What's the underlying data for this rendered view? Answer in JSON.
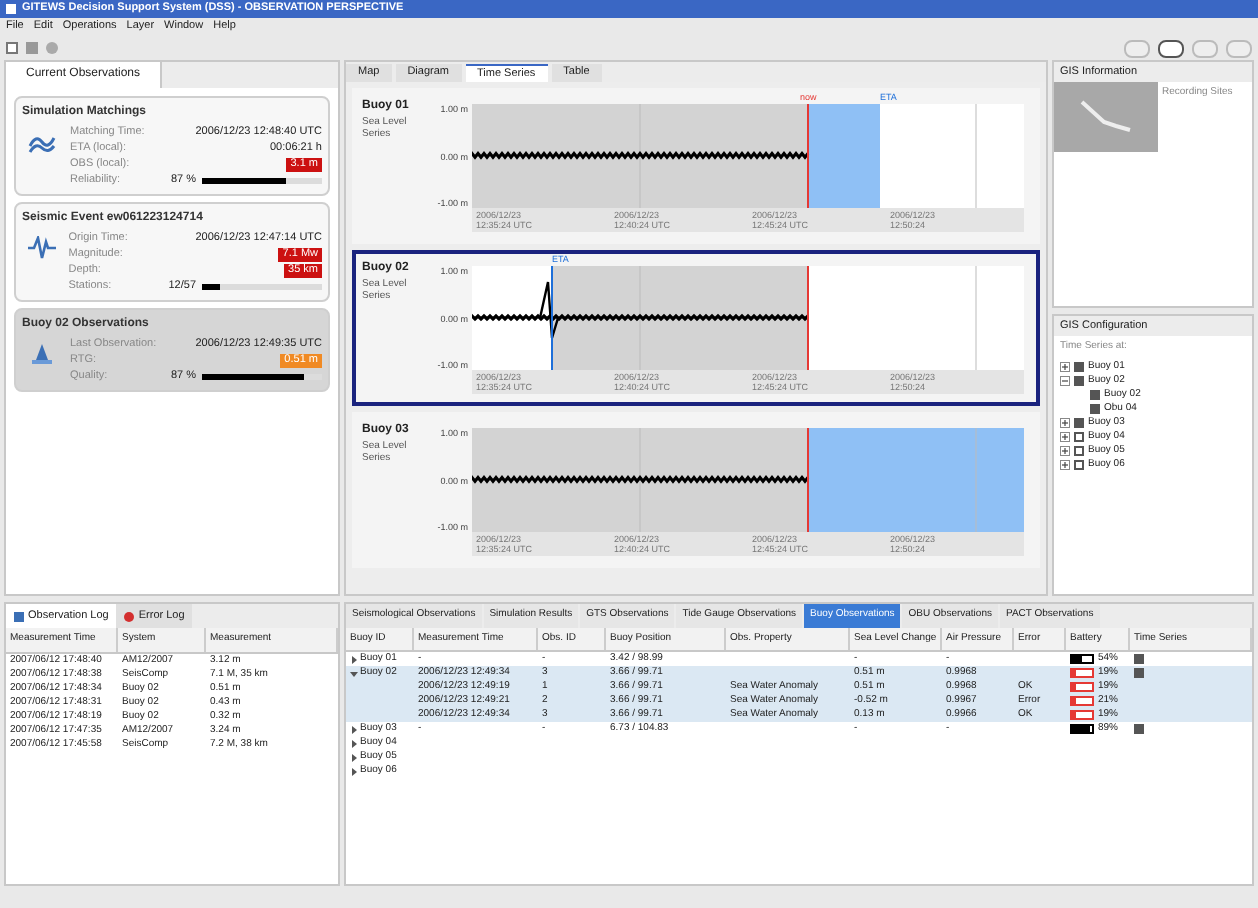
{
  "window": {
    "title": "GITEWS Decision Support System (DSS) - OBSERVATION PERSPECTIVE"
  },
  "menu": [
    "File",
    "Edit",
    "Operations",
    "Layer",
    "Window",
    "Help"
  ],
  "perspectives": [
    {
      "selected": false
    },
    {
      "selected": true
    },
    {
      "selected": false
    },
    {
      "selected": false
    }
  ],
  "current_observations": {
    "tab": "Current Observations",
    "cards": [
      {
        "title": "Simulation Matchings",
        "selected": false,
        "rows": [
          {
            "kind": "value",
            "label": "Matching Time:",
            "value": "2006/12/23 12:48:40 UTC"
          },
          {
            "kind": "value",
            "label": "ETA (local):",
            "value": "00:06:21 h"
          },
          {
            "kind": "badge",
            "label": "OBS (local):",
            "value": "3.1 m",
            "color": "#cc1111"
          },
          {
            "kind": "bar",
            "label": "Reliability:",
            "value": "87 %",
            "level": 0.7
          }
        ]
      },
      {
        "title": "Seismic Event ew061223124714",
        "selected": false,
        "rows": [
          {
            "kind": "value",
            "label": "Origin Time:",
            "value": "2006/12/23 12:47:14 UTC"
          },
          {
            "kind": "badge",
            "label": "Magnitude:",
            "value": "7.1 Mw",
            "color": "#cc1111"
          },
          {
            "kind": "badge",
            "label": "Depth:",
            "value": "35 km",
            "color": "#cc1111"
          },
          {
            "kind": "bar",
            "label": "Stations:",
            "value": "12/57",
            "level": 0.15
          }
        ]
      },
      {
        "title": "Buoy 02 Observations",
        "selected": true,
        "rows": [
          {
            "kind": "value",
            "label": "Last Observation:",
            "value": "2006/12/23 12:49:35 UTC"
          },
          {
            "kind": "badge",
            "label": "RTG:",
            "value": "0.51 m",
            "color": "#f08a24"
          },
          {
            "kind": "bar",
            "label": "Quality:",
            "value": "87 %",
            "level": 0.85
          }
        ]
      }
    ]
  },
  "center_tabs": [
    {
      "label": "Map",
      "selected": false
    },
    {
      "label": "Diagram",
      "selected": false
    },
    {
      "label": "Time Series",
      "selected": true
    },
    {
      "label": "Table",
      "selected": false
    }
  ],
  "charts": [
    {
      "name": "Buoy 01",
      "subtitle": "Sea Level Series",
      "selected": false,
      "kind": "forecast_short",
      "yticks": [
        "1.00 m",
        "0.00 m",
        "-1.00 m"
      ],
      "xlabels": [
        [
          "2006/12/23",
          "12:35:24 UTC"
        ],
        [
          "2006/12/23",
          "12:40:24 UTC"
        ],
        [
          "2006/12/23",
          "12:45:24 UTC"
        ],
        [
          "2006/12/23",
          "12:50:24"
        ]
      ],
      "markers": [
        {
          "kind": "now",
          "label": "now"
        },
        {
          "kind": "eta",
          "label": "ETA"
        }
      ]
    },
    {
      "name": "Buoy 02",
      "subtitle": "Sea Level Series",
      "selected": true,
      "kind": "arrival",
      "yticks": [
        "1.00 m",
        "0.00 m",
        "-1.00 m"
      ],
      "xlabels": [
        [
          "2006/12/23",
          "12:35:24 UTC"
        ],
        [
          "2006/12/23",
          "12:40:24 UTC"
        ],
        [
          "2006/12/23",
          "12:45:24 UTC"
        ],
        [
          "2006/12/23",
          "12:50:24"
        ]
      ],
      "markers": [
        {
          "kind": "eta",
          "label": "ETA"
        }
      ]
    },
    {
      "name": "Buoy 03",
      "subtitle": "Sea Level Series",
      "selected": false,
      "kind": "forecast_long",
      "yticks": [
        "1.00 m",
        "0.00 m",
        "-1.00 m"
      ],
      "xlabels": [
        [
          "2006/12/23",
          "12:35:24 UTC"
        ],
        [
          "2006/12/23",
          "12:40:24 UTC"
        ],
        [
          "2006/12/23",
          "12:45:24 UTC"
        ],
        [
          "2006/12/23",
          "12:50:24"
        ]
      ]
    }
  ],
  "gis_information": {
    "title": "GIS Information",
    "caption": "Recording Sites"
  },
  "gis_configuration": {
    "title": "GIS Configuration",
    "heading": "Time Series at:",
    "items": [
      {
        "label": "Buoy 01",
        "checked": true,
        "expanded": false
      },
      {
        "label": "Buoy 02",
        "checked": true,
        "expanded": true,
        "children": [
          {
            "label": "Buoy 02",
            "checked": true
          },
          {
            "label": "Obu 04",
            "checked": true
          }
        ]
      },
      {
        "label": "Buoy 03",
        "checked": true,
        "expanded": false
      },
      {
        "label": "Buoy 04",
        "checked": false,
        "expanded": false
      },
      {
        "label": "Buoy 05",
        "checked": false,
        "expanded": false
      },
      {
        "label": "Buoy 06",
        "checked": false,
        "expanded": false
      }
    ]
  },
  "log_tabs": [
    {
      "label": "Observation Log",
      "selected": true
    },
    {
      "label": "Error Log",
      "selected": false
    }
  ],
  "log_table": {
    "columns": [
      "Measurement Time",
      "System",
      "Measurement"
    ],
    "rows": [
      [
        "2007/06/12 17:48:40",
        "AM12/2007",
        "3.12 m"
      ],
      [
        "2007/06/12 17:48:38",
        "SeisComp",
        "7.1 M, 35 km"
      ],
      [
        "2007/06/12 17:48:34",
        "Buoy 02",
        "0.51 m"
      ],
      [
        "2007/06/12 17:48:31",
        "Buoy 02",
        "0.43 m"
      ],
      [
        "2007/06/12 17:48:19",
        "Buoy 02",
        "0.32 m"
      ],
      [
        "2007/06/12 17:47:35",
        "AM12/2007",
        "3.24 m"
      ],
      [
        "2007/06/12 17:45:58",
        "SeisComp",
        "7.2 M, 38 km"
      ]
    ]
  },
  "observation_tabs": [
    {
      "label": "Seismological Observations",
      "selected": false
    },
    {
      "label": "Simulation Results",
      "selected": false
    },
    {
      "label": "GTS Observations",
      "selected": false
    },
    {
      "label": "Tide Gauge Observations",
      "selected": false
    },
    {
      "label": "Buoy Observations",
      "selected": true
    },
    {
      "label": "OBU Observations",
      "selected": false
    },
    {
      "label": "PACT Observations",
      "selected": false
    }
  ],
  "buoy_table": {
    "columns": [
      "Buoy ID",
      "Measurement Time",
      "Obs. ID",
      "Buoy Position",
      "Obs. Property",
      "Sea Level Change",
      "Air Pressure",
      "Error",
      "Battery",
      "Time Series"
    ],
    "rows": [
      {
        "expanded": false,
        "cells": [
          "Buoy 01",
          "-",
          "-",
          "3.42 / 98.99",
          "",
          "-",
          "-",
          ""
        ],
        "battery": {
          "level": 0.54,
          "reading": "54%"
        },
        "time_series": true
      },
      {
        "expanded": true,
        "cells": [
          "Buoy 02",
          "2006/12/23 12:49:34",
          "3",
          "3.66 / 99.71",
          "",
          "0.51 m",
          "0.9968",
          ""
        ],
        "battery": {
          "level": 0.19,
          "reading": "19%"
        },
        "time_series": true,
        "children": [
          {
            "cells": [
              "",
              "2006/12/23 12:49:19",
              "1",
              "3.66 / 99.71",
              "Sea Water Anomaly",
              "0.51 m",
              "0.9968",
              "OK"
            ],
            "battery": {
              "level": 0.19,
              "reading": "19%"
            }
          },
          {
            "cells": [
              "",
              "2006/12/23 12:49:21",
              "2",
              "3.66 / 99.71",
              "Sea Water Anomaly",
              "-0.52 m",
              "0.9967",
              "Error"
            ],
            "battery": {
              "level": 0.21,
              "reading": "21%"
            }
          },
          {
            "cells": [
              "",
              "2006/12/23 12:49:34",
              "3",
              "3.66 / 99.71",
              "Sea Water Anomaly",
              "0.13 m",
              "0.9966",
              "OK"
            ],
            "battery": {
              "level": 0.19,
              "reading": "19%"
            }
          }
        ]
      },
      {
        "expanded": false,
        "cells": [
          "Buoy 03",
          "-",
          "-",
          "6.73 / 104.83",
          "",
          "-",
          "-",
          ""
        ],
        "battery": {
          "level": 0.89,
          "reading": "89%"
        },
        "time_series": true
      },
      {
        "expanded": false,
        "cells": [
          "Buoy 04"
        ],
        "time_series": false
      },
      {
        "expanded": false,
        "cells": [
          "Buoy 05"
        ],
        "time_series": false
      },
      {
        "expanded": false,
        "cells": [
          "Buoy 06"
        ],
        "time_series": false
      }
    ]
  }
}
